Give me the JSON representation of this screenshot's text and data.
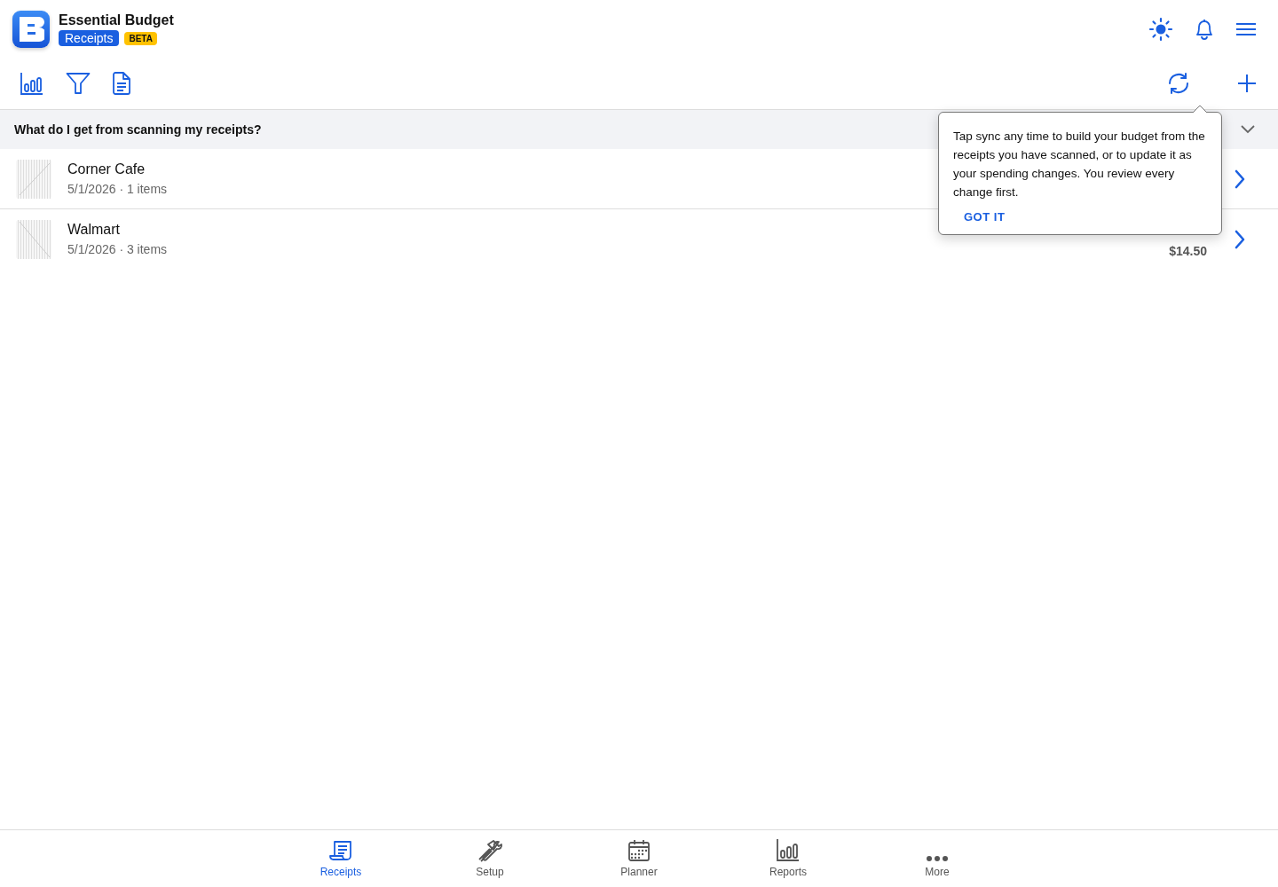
{
  "app": {
    "title": "Essential Budget",
    "section": "Receipts",
    "badge": "BETA"
  },
  "faq": {
    "question": "What do I get from scanning my receipts?",
    "expanded": false
  },
  "receipts": [
    {
      "merchant": "Corner Cafe",
      "meta": "5/1/2026 · 1 items"
    },
    {
      "merchant": "Walmart",
      "meta": "5/1/2026 · 3 items",
      "amount": "$14.50"
    }
  ],
  "popover": {
    "text": "Tap sync any time to build your budget from the receipts you have scanned, or to update it as your spending changes. You review every change first.",
    "action": "GOT IT"
  },
  "tabs": [
    {
      "label": "Receipts",
      "selected": true
    },
    {
      "label": "Setup",
      "selected": false
    },
    {
      "label": "Planner",
      "selected": false
    },
    {
      "label": "Reports",
      "selected": false
    },
    {
      "label": "More",
      "selected": false
    }
  ]
}
